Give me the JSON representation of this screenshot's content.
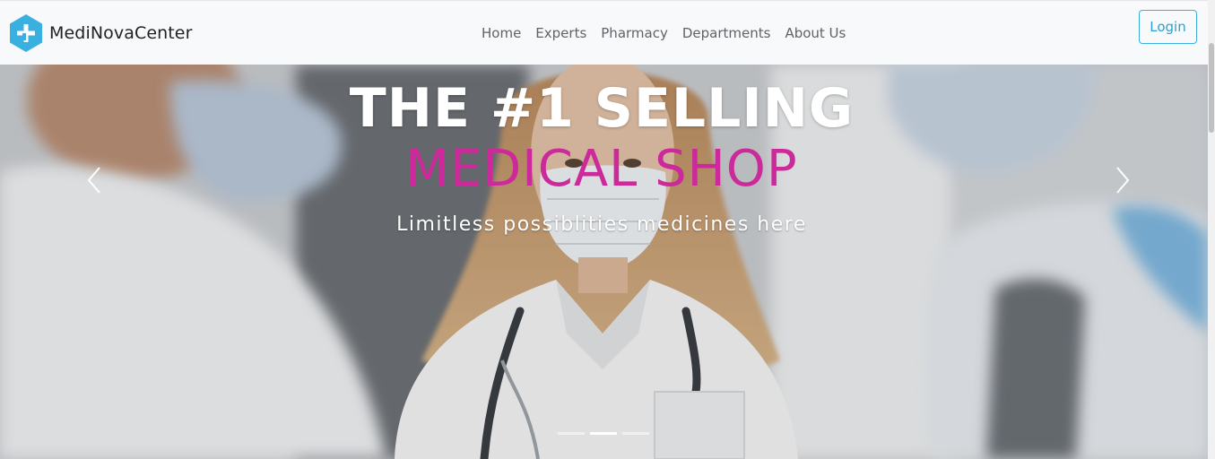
{
  "brand": {
    "name": "MediNovaCenter",
    "logo_color": "#3ab0e0",
    "logo_icon": "medical-cross-icon"
  },
  "nav": {
    "links": [
      "Home",
      "Experts",
      "Pharmacy",
      "Departments",
      "About Us"
    ],
    "login_label": "Login"
  },
  "hero": {
    "title": "THE #1 SELLING",
    "subtitle": "MEDICAL SHOP",
    "tagline": "Limitless possiblities medicines here",
    "subtitle_color": "#cc2a9a",
    "prev_icon": "chevron-left-icon",
    "next_icon": "chevron-right-icon",
    "slides_count": 3,
    "active_slide": 2
  }
}
